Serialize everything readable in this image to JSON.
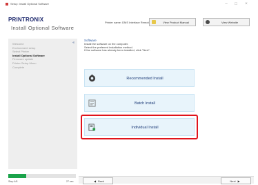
{
  "window": {
    "title": "Setup: Install Optional Software",
    "minimize_glyph": "–",
    "maximize_glyph": "□",
    "close_glyph": "×"
  },
  "header": {
    "brand": "PRINTRONIX",
    "page_heading": "Install Optional Software",
    "model_label": "Printer name: DMS Interface Remote",
    "view_manual_label": "View Product Manual",
    "view_website_label": "View Website"
  },
  "sidebar": {
    "collapse_glyph": "«",
    "steps": [
      {
        "label": "Welcome",
        "active": false
      },
      {
        "label": "Environment setup",
        "active": false
      },
      {
        "label": "Select Printer",
        "active": false
      },
      {
        "label": "Install Optional Software",
        "active": true
      },
      {
        "label": "Firmware update",
        "active": false
      },
      {
        "label": "Printer Setup Menu",
        "active": false
      },
      {
        "label": "Complete",
        "active": false
      }
    ]
  },
  "main": {
    "panel_title": "Software",
    "instructions": [
      "Install the software on the computer.",
      "Select the preferred installation method.",
      "If the software has already been installed, click \"Next\"."
    ],
    "options": [
      {
        "label": "Recommended Install",
        "icon": "recommended-install-icon"
      },
      {
        "label": "Batch Install",
        "icon": "batch-install-icon"
      },
      {
        "label": "Individual Install",
        "icon": "individual-install-icon",
        "highlighted": true
      }
    ]
  },
  "progress": {
    "fraction": 0.27,
    "left_label": "Step 4/8",
    "right_label": "27 sec"
  },
  "footer": {
    "back_label": "Back",
    "next_label": "Next",
    "back_arrow": "◀",
    "next_arrow": "▶"
  },
  "colors": {
    "brand": "#1f2a6e",
    "option_bg": "#e8f4fb",
    "highlight_border": "#e0141c",
    "progress_green": "#1aa34a",
    "sidebar_bg": "#eeeeee"
  }
}
